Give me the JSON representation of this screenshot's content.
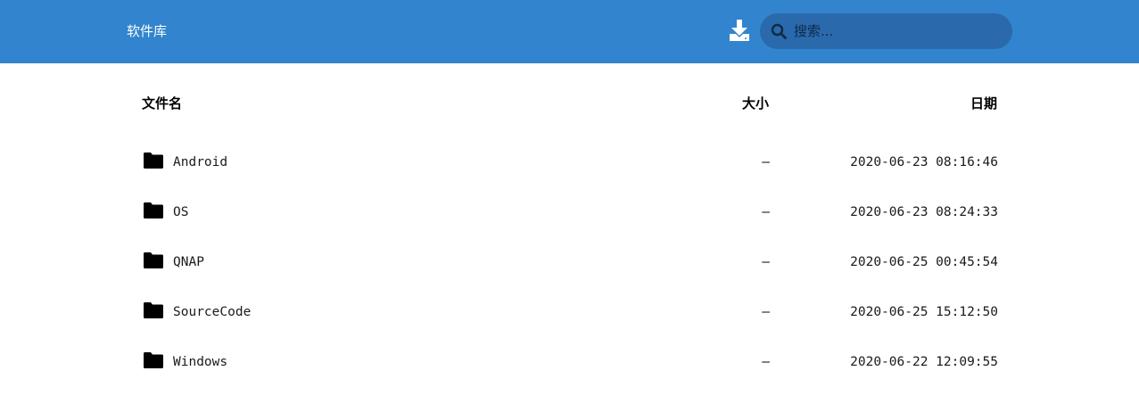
{
  "header": {
    "brand": "软件库",
    "download_icon": "download-icon",
    "search": {
      "placeholder": "搜索...",
      "value": "",
      "icon": "search-icon"
    },
    "bar_color": "#3184cd"
  },
  "table": {
    "columns": {
      "name": "文件名",
      "size": "大小",
      "date": "日期"
    },
    "rows": [
      {
        "icon": "folder-icon",
        "name": "Android",
        "size": "—",
        "date": "2020-06-23 08:16:46"
      },
      {
        "icon": "folder-icon",
        "name": "OS",
        "size": "—",
        "date": "2020-06-23 08:24:33"
      },
      {
        "icon": "folder-icon",
        "name": "QNAP",
        "size": "—",
        "date": "2020-06-25 00:45:54"
      },
      {
        "icon": "folder-icon",
        "name": "SourceCode",
        "size": "—",
        "date": "2020-06-25 15:12:50"
      },
      {
        "icon": "folder-icon",
        "name": "Windows",
        "size": "—",
        "date": "2020-06-22 12:09:55"
      }
    ]
  }
}
